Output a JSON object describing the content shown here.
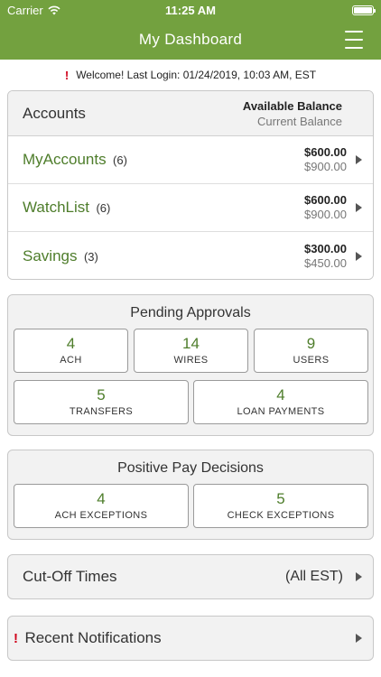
{
  "status_bar": {
    "carrier": "Carrier",
    "time": "11:25 AM",
    "battery_level": 1.0
  },
  "nav": {
    "title": "My Dashboard"
  },
  "welcome": {
    "text": "Welcome! Last Login: 01/24/2019, 10:03 AM, EST"
  },
  "accounts": {
    "title": "Accounts",
    "available_label": "Available Balance",
    "current_label": "Current Balance",
    "items": [
      {
        "name": "MyAccounts",
        "count": "(6)",
        "available": "$600.00",
        "current": "$900.00"
      },
      {
        "name": "WatchList",
        "count": "(6)",
        "available": "$600.00",
        "current": "$900.00"
      },
      {
        "name": "Savings",
        "count": "(3)",
        "available": "$300.00",
        "current": "$450.00"
      }
    ]
  },
  "pending": {
    "title": "Pending Approvals",
    "tiles": [
      {
        "count": "4",
        "label": "ACH"
      },
      {
        "count": "14",
        "label": "WIRES"
      },
      {
        "count": "9",
        "label": "USERS"
      },
      {
        "count": "5",
        "label": "TRANSFERS"
      },
      {
        "count": "4",
        "label": "LOAN PAYMENTS"
      }
    ]
  },
  "positive_pay": {
    "title": "Positive Pay Decisions",
    "tiles": [
      {
        "count": "4",
        "label": "ACH EXCEPTIONS"
      },
      {
        "count": "5",
        "label": "CHECK EXCEPTIONS"
      }
    ]
  },
  "cutoff": {
    "title": "Cut-Off Times",
    "note": "(All EST)"
  },
  "notifications": {
    "title": "Recent Notifications"
  },
  "colors": {
    "brand_green": "#73a13f",
    "link_green": "#4e7d2b",
    "alert_red": "#d0021b"
  }
}
